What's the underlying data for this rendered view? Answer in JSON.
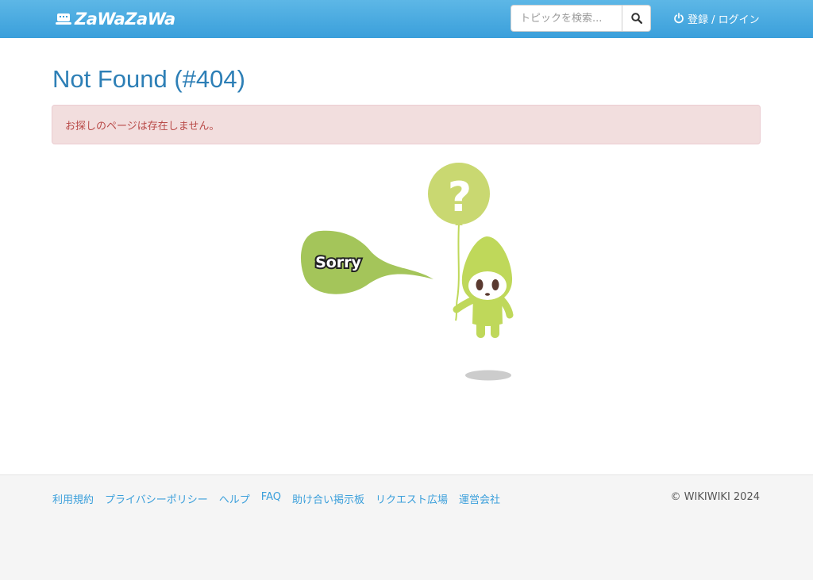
{
  "header": {
    "logo_text": "ZaWaZaWa",
    "search_placeholder": "トピックを検索...",
    "login_label": "登録 / ログイン"
  },
  "main": {
    "title": "Not Found (#404)",
    "alert_message": "お探しのページは存在しません。",
    "illustration": {
      "speech_text": "Sorry",
      "balloon_symbol": "?"
    }
  },
  "footer": {
    "links": [
      "利用規約",
      "プライバシーポリシー",
      "ヘルプ",
      "FAQ",
      "助け合い掲示板",
      "リクエスト広場",
      "運営会社"
    ],
    "copyright": "© WIKIWIKI 2024"
  },
  "icons": {
    "search": "search-icon",
    "power": "power-icon",
    "logo": "logo-icon"
  },
  "colors": {
    "navbar": "#3a9fdb",
    "title": "#2d7fb6",
    "alert_bg": "#f2dede",
    "alert_text": "#b94a48",
    "link": "#3a9fdb",
    "mascot_green": "#bfd85a",
    "bubble_green": "#a4c55a"
  }
}
